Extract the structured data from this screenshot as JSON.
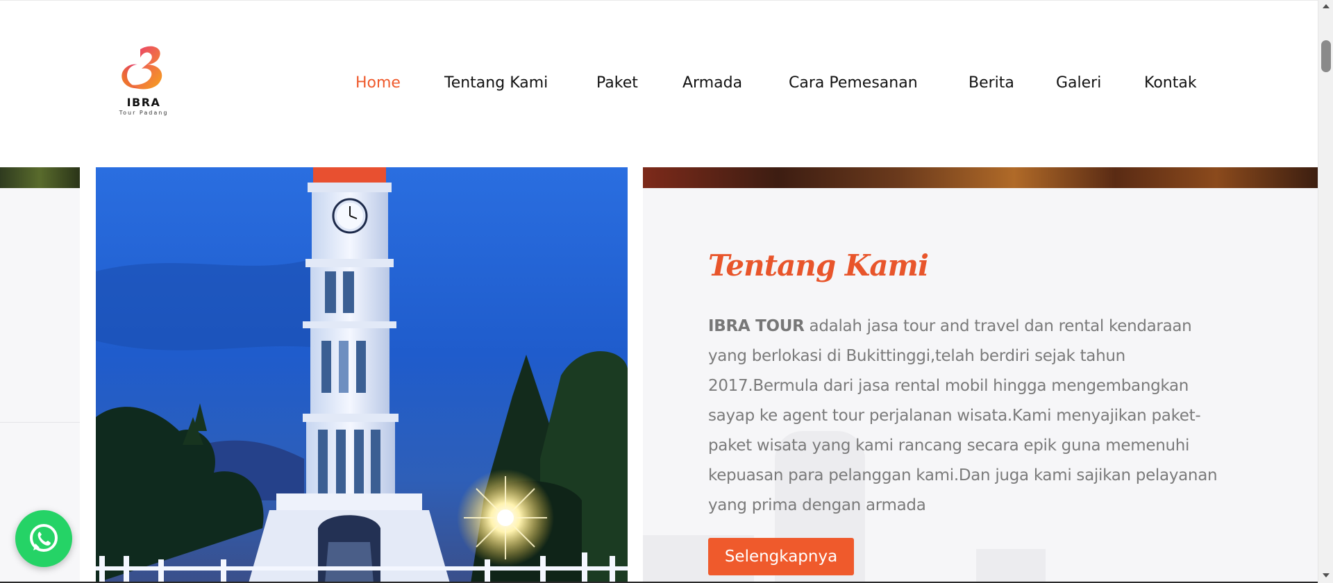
{
  "logo": {
    "name": "IBRA",
    "tagline": "Tour Padang"
  },
  "nav": {
    "items": [
      {
        "label": "Home",
        "active": true
      },
      {
        "label": "Tentang Kami",
        "active": false
      },
      {
        "label": "Paket",
        "active": false
      },
      {
        "label": "Armada",
        "active": false
      },
      {
        "label": "Cara Pemesanan",
        "active": false
      },
      {
        "label": "Berita",
        "active": false
      },
      {
        "label": "Galeri",
        "active": false
      },
      {
        "label": "Kontak",
        "active": false
      }
    ]
  },
  "about": {
    "title": "Tentang Kami",
    "brand": "IBRA TOUR",
    "body": " adalah jasa tour and travel dan rental kendaraan yang berlokasi di Bukittinggi,telah berdiri sejak tahun 2017.Bermula dari jasa rental mobil hingga mengembangkan sayap ke agent tour perjalanan wisata.Kami menyajikan paket-paket wisata yang kami rancang secara epik guna memenuhi kepuasan para pelanggan kami.Dan juga kami sajikan pelayanan yang prima dengan armada",
    "button_label": "Selengkapnya"
  },
  "icons": {
    "whatsapp": "whatsapp-icon"
  },
  "colors": {
    "accent": "#ef5a2c",
    "whatsapp": "#25d366",
    "text": "#7a7a7a"
  }
}
